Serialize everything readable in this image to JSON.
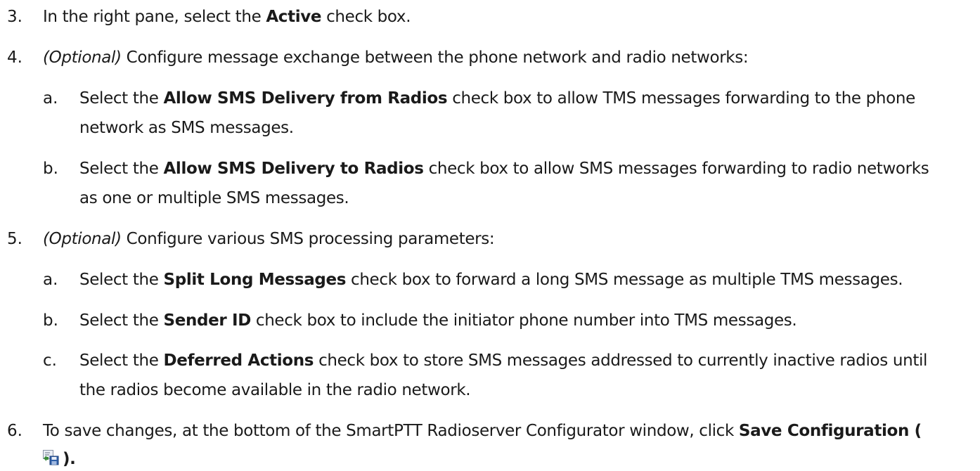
{
  "steps": [
    {
      "number": "3.",
      "parts": [
        "In the right pane, select the ",
        "Active",
        " check box."
      ]
    },
    {
      "number": "4.",
      "optional": "(Optional)",
      "text": " Configure message exchange between the phone network and radio networks:",
      "substeps": [
        {
          "letter": "a.",
          "lines": [
            [
              "Select the ",
              "Allow SMS Delivery from Radios",
              " check box to allow TMS messages forwarding to the phone"
            ],
            [
              "network as SMS messages."
            ]
          ]
        },
        {
          "letter": "b.",
          "lines": [
            [
              "Select the ",
              "Allow SMS Delivery to Radios",
              " check box to allow SMS messages forwarding to radio networks"
            ],
            [
              "as one or multiple SMS messages."
            ]
          ]
        }
      ]
    },
    {
      "number": "5.",
      "optional": "(Optional)",
      "text": " Configure various SMS processing parameters:",
      "substeps": [
        {
          "letter": "a.",
          "lines": [
            [
              "Select the ",
              "Split Long Messages",
              " check box to forward a long SMS message as multiple TMS messages."
            ]
          ]
        },
        {
          "letter": "b.",
          "lines": [
            [
              "Select the ",
              "Sender ID",
              " check box to include the initiator phone number into TMS messages."
            ]
          ]
        },
        {
          "letter": "c.",
          "lines": [
            [
              "Select the ",
              "Deferred Actions",
              " check box to store SMS messages addressed to currently inactive radios until"
            ],
            [
              "the radios become available in the radio network."
            ]
          ]
        }
      ]
    },
    {
      "number": "6.",
      "lines": [
        [
          "To save changes, at the bottom of the SmartPTT Radioserver Configurator window, click ",
          "Save Configuration ("
        ],
        [
          ")."
        ]
      ],
      "icon": "save-configuration-icon"
    }
  ]
}
